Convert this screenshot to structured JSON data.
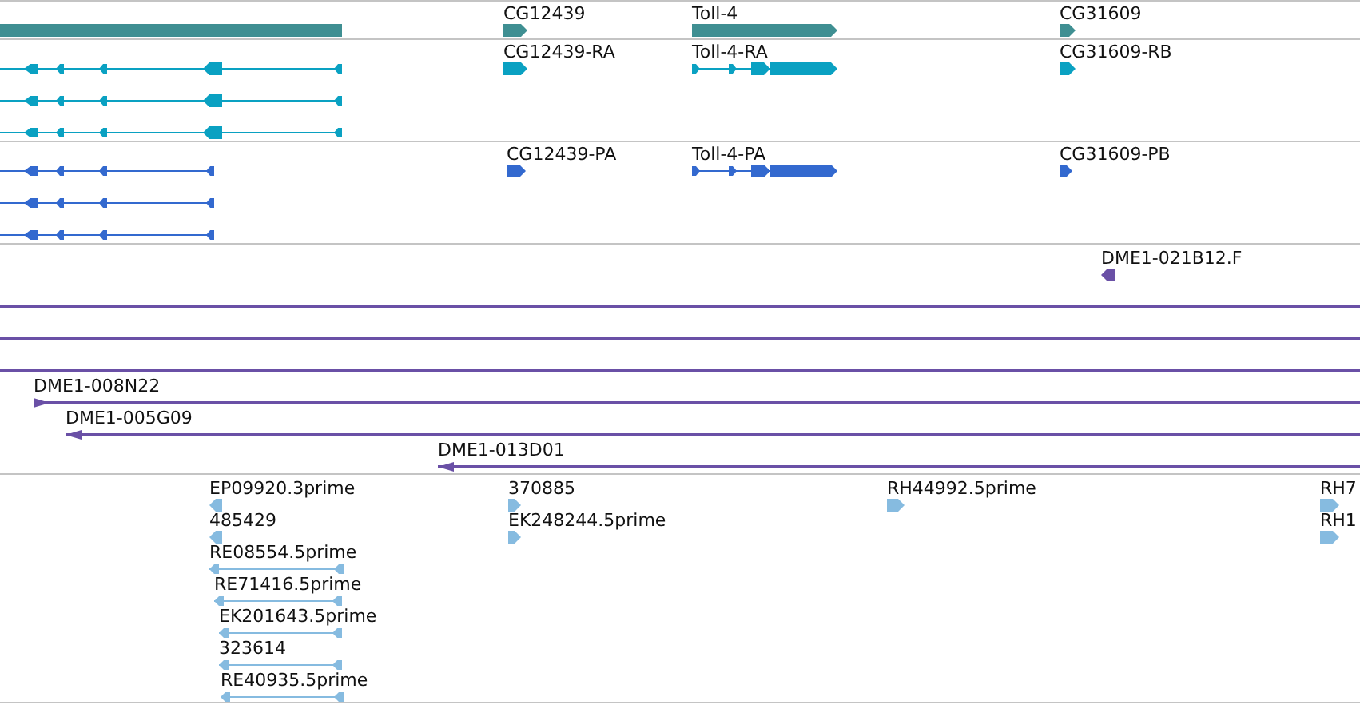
{
  "tracks": [
    {
      "kind": "gene",
      "features": [
        {
          "kind": "gene"
        },
        {
          "label": "CG12439",
          "kind": "gene",
          "forward": true
        },
        {
          "label": "Toll-4",
          "kind": "gene",
          "forward": true
        },
        {
          "label": "CG31609",
          "kind": "gene",
          "forward": true
        }
      ]
    },
    {
      "kind": "transcript",
      "features": [
        {
          "kind": "spliced",
          "forward": false
        },
        {
          "kind": "spliced",
          "forward": false
        },
        {
          "kind": "spliced",
          "forward": false
        },
        {
          "label": "CG12439-RA",
          "kind": "single",
          "forward": true
        },
        {
          "label": "Toll-4-RA",
          "kind": "spliced",
          "forward": true
        },
        {
          "label": "CG31609-RB",
          "kind": "single",
          "forward": true
        }
      ]
    },
    {
      "kind": "protein",
      "features": [
        {
          "kind": "spliced",
          "forward": false
        },
        {
          "kind": "spliced",
          "forward": false
        },
        {
          "kind": "spliced",
          "forward": false
        },
        {
          "label": "CG12439-PA",
          "kind": "single",
          "forward": true
        },
        {
          "label": "Toll-4-PA",
          "kind": "spliced",
          "forward": true
        },
        {
          "label": "CG31609-PB",
          "kind": "single",
          "forward": true
        }
      ]
    },
    {
      "kind": "clone",
      "features": [
        {
          "label": "DME1-021B12.F",
          "kind": "single",
          "forward": false
        },
        {
          "kind": "span"
        },
        {
          "kind": "span"
        },
        {
          "kind": "span"
        },
        {
          "label": "DME1-008N22",
          "kind": "span",
          "forward": true
        },
        {
          "label": "DME1-005G09",
          "kind": "span",
          "forward": false
        },
        {
          "label": "DME1-013D01",
          "kind": "span",
          "forward": false
        }
      ]
    },
    {
      "kind": "est",
      "features": [
        {
          "label": "EP09920.3prime",
          "kind": "single",
          "forward": false
        },
        {
          "label": "485429",
          "kind": "single",
          "forward": false
        },
        {
          "label": "RE08554.5prime",
          "kind": "spliced",
          "forward": false
        },
        {
          "label": "RE71416.5prime",
          "kind": "spliced",
          "forward": false
        },
        {
          "label": "EK201643.5prime",
          "kind": "spliced",
          "forward": false
        },
        {
          "label": "323614",
          "kind": "spliced",
          "forward": false
        },
        {
          "label": "RE40935.5prime",
          "kind": "spliced",
          "forward": false
        },
        {
          "label": "370885",
          "kind": "single",
          "forward": true
        },
        {
          "label": "EK248244.5prime",
          "kind": "single",
          "forward": true
        },
        {
          "label": "RH44992.5prime",
          "kind": "single",
          "forward": true
        },
        {
          "label": "RH7",
          "kind": "single",
          "forward": true
        },
        {
          "label": "RH1",
          "kind": "single",
          "forward": true
        }
      ]
    }
  ]
}
